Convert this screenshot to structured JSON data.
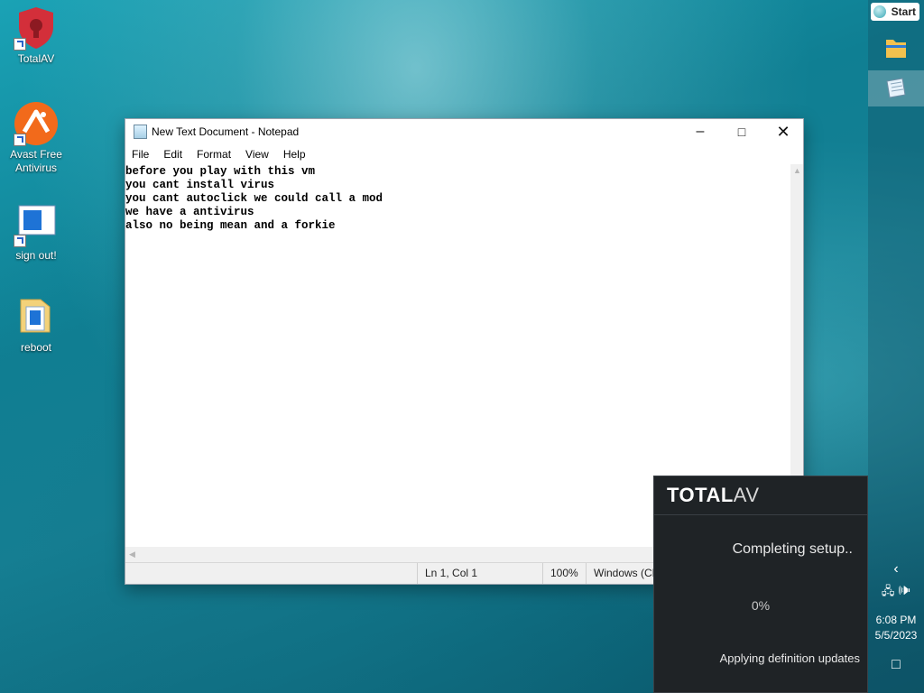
{
  "desktop": {
    "icons": [
      {
        "label": "TotalAV"
      },
      {
        "label": "Avast Free Antivirus"
      },
      {
        "label": "sign out!"
      },
      {
        "label": "reboot"
      }
    ]
  },
  "notepad": {
    "title": "New Text Document - Notepad",
    "menu": [
      "File",
      "Edit",
      "Format",
      "View",
      "Help"
    ],
    "content": "before you play with this vm\nyou cant install virus\nyou cant autoclick we could call a mod\nwe have a antivirus\nalso no being mean and a forkie",
    "status": {
      "position": "Ln 1, Col 1",
      "zoom": "100%",
      "encoding": "Windows (CR"
    }
  },
  "totalav": {
    "logo_bold": "TOTAL",
    "logo_light": "AV",
    "title": "Completing setup..",
    "percent": "0%",
    "status": "Applying definition updates"
  },
  "taskbar": {
    "start_label": "Start",
    "time": "6:08 PM",
    "date": "5/5/2023"
  },
  "colors": {
    "avast_orange": "#f26a1b",
    "totalav_red": "#d32f3a",
    "popup_bg": "#1f2326"
  }
}
